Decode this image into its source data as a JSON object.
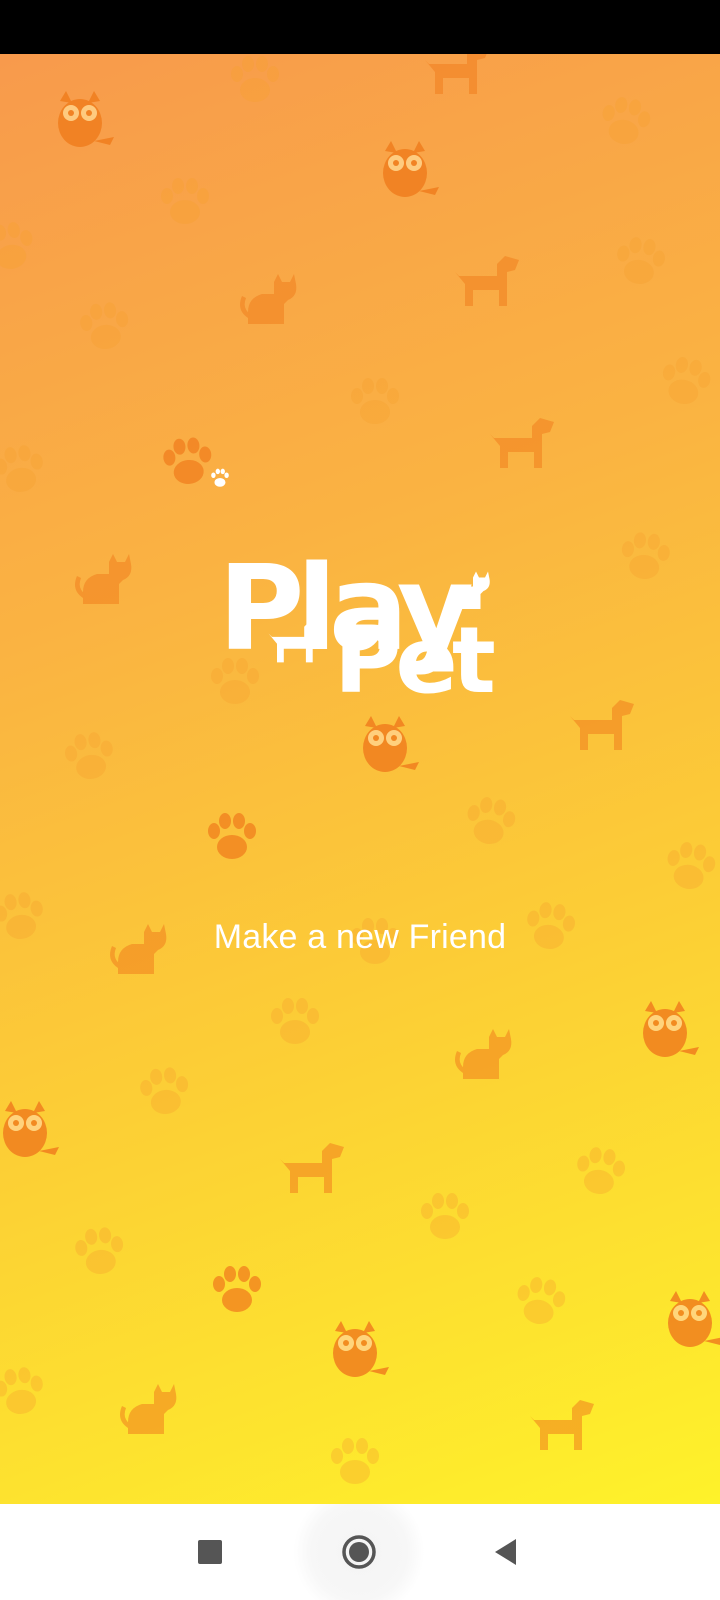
{
  "app": {
    "name_line1": "Play",
    "name_line2": "Pet",
    "tagline": "Make a new Friend"
  },
  "colors": {
    "gradient_top": "#F89A4C",
    "gradient_bottom": "#FEF22A",
    "pattern": "#F07E1E",
    "logo": "#FFFFFF"
  },
  "icons": {
    "pattern": [
      "paw-print-icon",
      "cat-icon",
      "dog-icon",
      "owl-icon"
    ],
    "logo": [
      "paw-icon",
      "cat-icon",
      "dog-icon"
    ]
  },
  "navigation": {
    "recents": "square-icon",
    "home": "circle-icon",
    "back": "triangle-back-icon"
  }
}
